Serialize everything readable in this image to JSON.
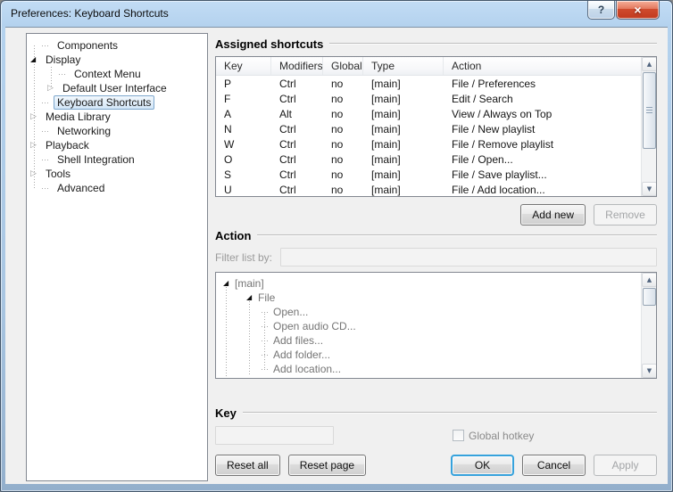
{
  "window": {
    "title": "Preferences: Keyboard Shortcuts"
  },
  "icons": {
    "help": "?",
    "close": "×",
    "expanded": "◢",
    "collapsed": "▷",
    "scroll_up": "▲",
    "scroll_down": "▼"
  },
  "colors": {
    "titlebar_glass": "#b4d2ee",
    "close_button_red": "#cf4b2e",
    "selection_border": "#7da7cd",
    "selection_fill": "#d3e6f7",
    "default_button_ring": "#36a2dc",
    "dialog_background": "#f0f0f0"
  },
  "nav_tree": {
    "items": [
      {
        "label": "Components",
        "expander": "none",
        "level": 0,
        "selected": false
      },
      {
        "label": "Display",
        "expander": "expanded",
        "level": 0,
        "selected": false
      },
      {
        "label": "Context Menu",
        "expander": "none",
        "level": 1,
        "selected": false
      },
      {
        "label": "Default User Interface",
        "expander": "collapsed",
        "level": 1,
        "selected": false
      },
      {
        "label": "Keyboard Shortcuts",
        "expander": "none",
        "level": 0,
        "selected": true
      },
      {
        "label": "Media Library",
        "expander": "collapsed",
        "level": 0,
        "selected": false
      },
      {
        "label": "Networking",
        "expander": "none",
        "level": 0,
        "selected": false
      },
      {
        "label": "Playback",
        "expander": "collapsed",
        "level": 0,
        "selected": false
      },
      {
        "label": "Shell Integration",
        "expander": "none",
        "level": 0,
        "selected": false
      },
      {
        "label": "Tools",
        "expander": "collapsed",
        "level": 0,
        "selected": false
      },
      {
        "label": "Advanced",
        "expander": "none",
        "level": 0,
        "selected": false
      }
    ]
  },
  "assigned": {
    "title": "Assigned shortcuts",
    "columns": [
      "Key",
      "Modifiers",
      "Global",
      "Type",
      "Action"
    ],
    "rows": [
      {
        "key": "P",
        "modifiers": "Ctrl",
        "global": "no",
        "type": "[main]",
        "action": "File / Preferences"
      },
      {
        "key": "F",
        "modifiers": "Ctrl",
        "global": "no",
        "type": "[main]",
        "action": "Edit / Search"
      },
      {
        "key": "A",
        "modifiers": "Alt",
        "global": "no",
        "type": "[main]",
        "action": "View / Always on Top"
      },
      {
        "key": "N",
        "modifiers": "Ctrl",
        "global": "no",
        "type": "[main]",
        "action": "File / New playlist"
      },
      {
        "key": "W",
        "modifiers": "Ctrl",
        "global": "no",
        "type": "[main]",
        "action": "File / Remove playlist"
      },
      {
        "key": "O",
        "modifiers": "Ctrl",
        "global": "no",
        "type": "[main]",
        "action": "File / Open..."
      },
      {
        "key": "S",
        "modifiers": "Ctrl",
        "global": "no",
        "type": "[main]",
        "action": "File / Save playlist..."
      },
      {
        "key": "U",
        "modifiers": "Ctrl",
        "global": "no",
        "type": "[main]",
        "action": "File / Add location..."
      }
    ],
    "buttons": {
      "add_new": "Add new",
      "remove": "Remove"
    }
  },
  "action_section": {
    "title": "Action",
    "filter_label": "Filter list by:",
    "filter_value": "",
    "tree": [
      {
        "label": "[main]",
        "expander": "expanded",
        "level": 0
      },
      {
        "label": "File",
        "expander": "expanded",
        "level": 1
      },
      {
        "label": "Open...",
        "expander": "none",
        "level": 2
      },
      {
        "label": "Open audio CD...",
        "expander": "none",
        "level": 2
      },
      {
        "label": "Add files...",
        "expander": "none",
        "level": 2
      },
      {
        "label": "Add folder...",
        "expander": "none",
        "level": 2
      },
      {
        "label": "Add location...",
        "expander": "none",
        "level": 2
      }
    ]
  },
  "key_section": {
    "title": "Key",
    "key_value": "",
    "global_hotkey_label": "Global hotkey",
    "checkbox_checked": false
  },
  "footer": {
    "reset_all": "Reset all",
    "reset_page": "Reset page",
    "ok": "OK",
    "cancel": "Cancel",
    "apply": "Apply"
  }
}
